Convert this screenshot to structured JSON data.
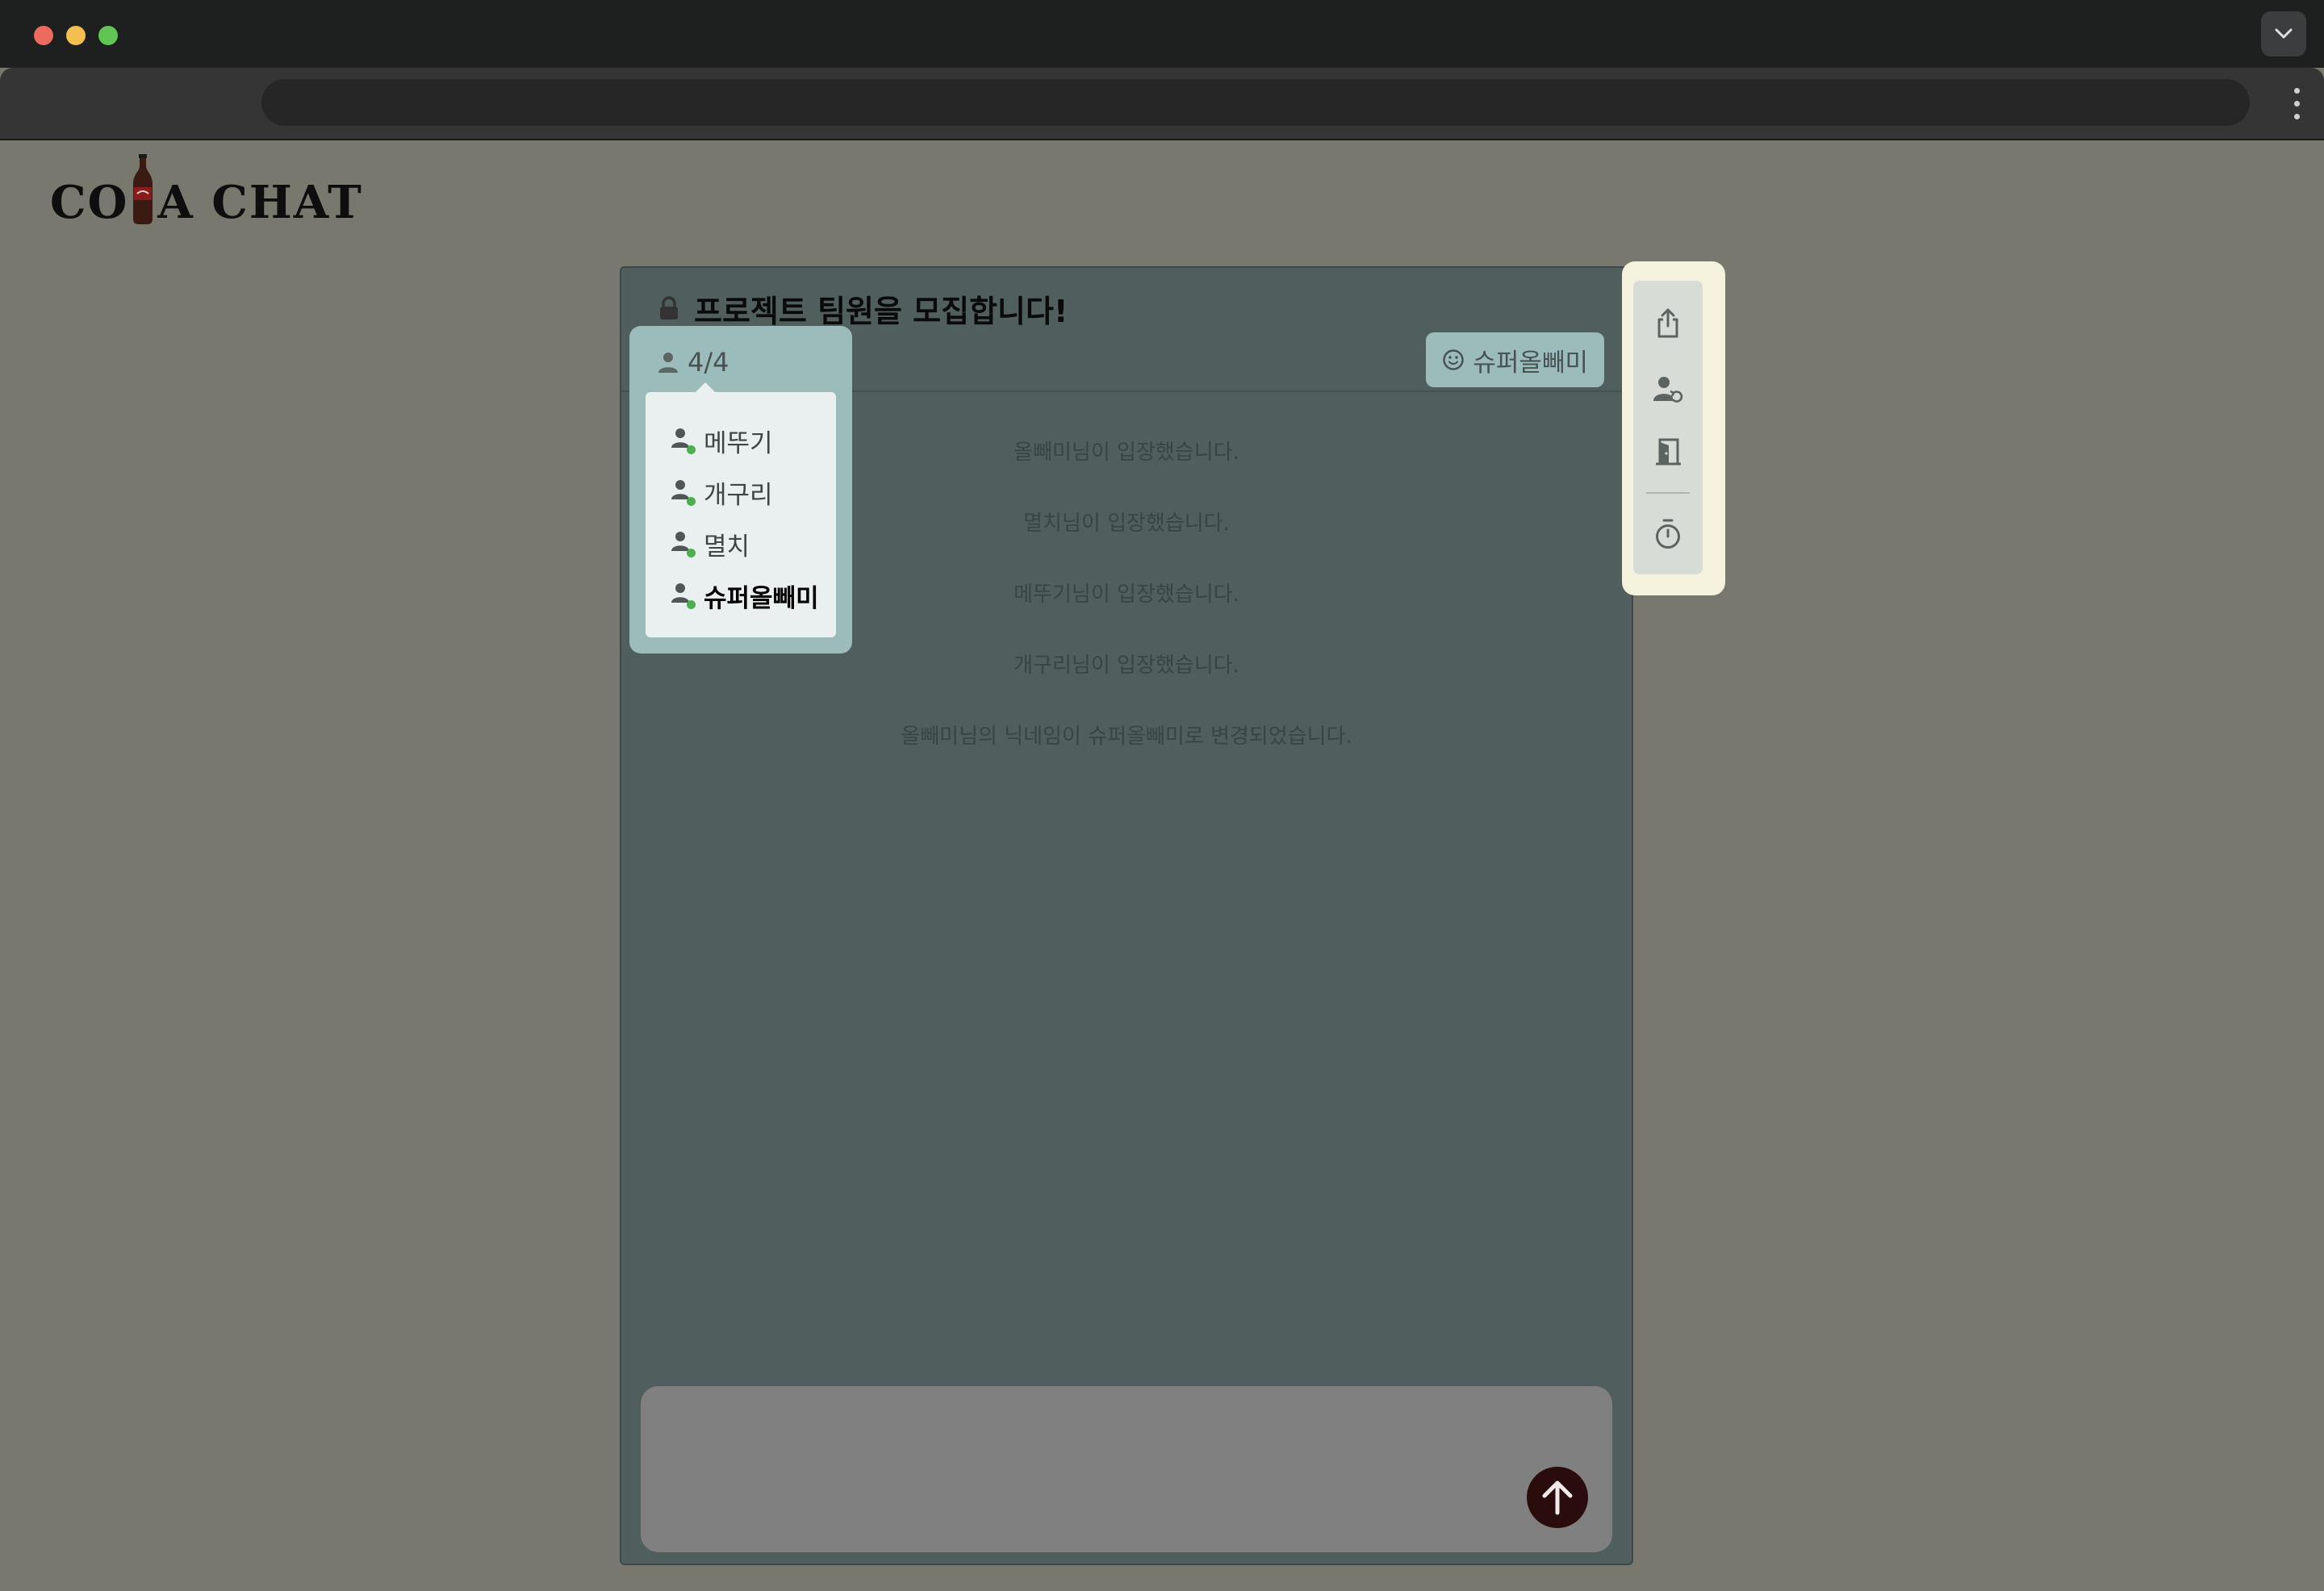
{
  "app": {
    "logo_text_left": "CO",
    "logo_text_right": "A CHAT"
  },
  "room": {
    "title": "프로젝트 팀원을 모집합니다!",
    "locked": true,
    "participant_count": "4/4",
    "my_nickname": "슈퍼올빼미"
  },
  "participants": [
    {
      "name": "메뚜기",
      "online": true,
      "is_me": false
    },
    {
      "name": "개구리",
      "online": true,
      "is_me": false
    },
    {
      "name": "멸치",
      "online": true,
      "is_me": false
    },
    {
      "name": "슈퍼올빼미",
      "online": true,
      "is_me": true
    }
  ],
  "messages": [
    {
      "type": "system",
      "text": "올빼미님이 입장했습니다."
    },
    {
      "type": "system",
      "text": "멸치님이 입장했습니다."
    },
    {
      "type": "system",
      "text": "메뚜기님이 입장했습니다."
    },
    {
      "type": "system",
      "text": "개구리님이 입장했습니다."
    },
    {
      "type": "system",
      "text": "올빼미님의 닉네임이 슈퍼올빼미로 변경되었습니다."
    }
  ],
  "composer": {
    "value": "",
    "send_icon": "arrow-up-icon"
  },
  "sidebar_icons": [
    "share-icon",
    "user-change-icon",
    "exit-door-icon",
    "timer-icon"
  ],
  "colors": {
    "page_bg": "#78786f",
    "chat_bg": "#505e5d",
    "accent_teal": "#9cbcbc",
    "sidebar_bg": "#f4f2dc",
    "send_button": "#2a0c0c",
    "online_dot": "#4caf50"
  }
}
